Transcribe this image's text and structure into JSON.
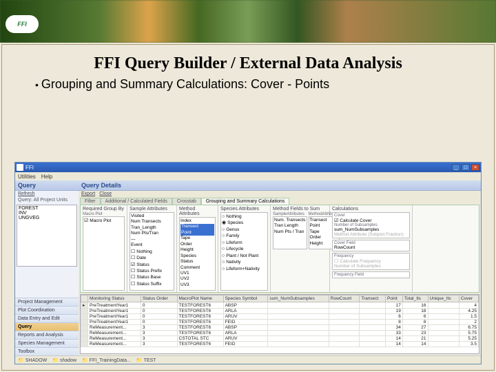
{
  "logo": "FFI",
  "slide": {
    "title": "FFI Query Builder / External Data Analysis",
    "subtitle": "Grouping and Summary Calculations: Cover - Points"
  },
  "app": {
    "title": "FFI",
    "menu": [
      "Utilities",
      "Help"
    ],
    "left": {
      "header": "Query",
      "actions": {
        "refresh": "Refresh"
      },
      "subheader": "Query: All Project Units",
      "tree": [
        "FOREST",
        "INV",
        "UNGVEG"
      ],
      "nav": [
        {
          "label": "Project Management",
          "sel": false
        },
        {
          "label": "Plot Coordination",
          "sel": false
        },
        {
          "label": "Data Entry and Edit",
          "sel": false
        },
        {
          "label": "Query",
          "sel": true
        },
        {
          "label": "Reports and Analysis",
          "sel": false
        },
        {
          "label": "Species Management",
          "sel": false
        },
        {
          "label": "Toolbox",
          "sel": false
        }
      ]
    },
    "details": {
      "header": "Query Details",
      "actions": {
        "export": "Export",
        "close": "Close"
      },
      "tabs": [
        "Filter",
        "Additional / Calculated Fields",
        "Crosstab",
        "Grouping and Summary Calculations"
      ],
      "groupby": {
        "header": "Required Group By",
        "sub": "Macro Plot",
        "items": [
          {
            "label": "Macro Plot",
            "checked": true
          }
        ]
      },
      "sampleAttr": {
        "header": "Sample Attributes",
        "items": [
          {
            "label": "Visited"
          },
          {
            "label": "Num Transects"
          },
          {
            "label": "Tran_Length"
          },
          {
            "label": "Num Pts/Tran"
          },
          {
            "label": "—"
          },
          {
            "label": "Event"
          },
          {
            "label": "Nothing",
            "checked": false
          },
          {
            "label": "Date",
            "checked": false
          },
          {
            "label": "Status",
            "checked": true
          },
          {
            "label": "Status Prefix",
            "checked": false
          },
          {
            "label": "Status Base",
            "checked": false
          },
          {
            "label": "Status Suffix",
            "checked": false
          }
        ]
      },
      "methodAttr": {
        "header": "Method Attributes",
        "items": [
          "Index",
          "Transect",
          "Point",
          "Tape",
          "Order",
          "Height",
          "Species",
          "Status",
          "Comment",
          "UV1",
          "UV2",
          "UV3"
        ],
        "selected": [
          1,
          2
        ]
      },
      "speciesAttr": {
        "header": "Species Attributes",
        "items": [
          {
            "label": "Nothing",
            "sel": false
          },
          {
            "label": "Species",
            "sel": true
          },
          {
            "label": "Genus",
            "sel": false
          },
          {
            "label": "Family",
            "sel": false
          },
          {
            "label": "Lifeform",
            "sel": false
          },
          {
            "label": "Lifecycle",
            "sel": false
          },
          {
            "label": "Plant / Not Plant",
            "sel": false
          },
          {
            "label": "Nativity",
            "sel": false
          },
          {
            "label": "Lifeform+Nativity",
            "sel": false
          }
        ]
      },
      "metrics": {
        "header": "Method Fields to Sum",
        "sampleHdr": "SampleAttributes",
        "sampleItems": [
          "Num. Transects",
          "Tran Length",
          "Num Pts / Tran"
        ],
        "methodHdr": "MethodAttributes",
        "methodItems": [
          "Transect",
          "Point",
          "Tape",
          "Order",
          "Height"
        ]
      },
      "calc": {
        "header": "Calculations",
        "coverLabel": "Cover",
        "coverItems": [
          "Calculate Cover",
          "Number of Subsamples",
          "sum_NumSubsamples",
          "Method Attribute (Subplot Fraction)"
        ],
        "coverFieldLabel": "Cover Field",
        "coverFieldValue": "RowCount",
        "freqLabel": "Frequency",
        "freqItems": [
          "Calculate Frequency",
          "Number of Subsamples"
        ],
        "freqFieldLabel": "Frequency Field"
      }
    },
    "grid": {
      "cols": [
        "Monitoring Status",
        "Status Order",
        "MacroPlot Name",
        "Species Symbol",
        "sum_NumSubsamples",
        "RowCount",
        "Transect",
        "Point",
        "Total_Its",
        "Unique_Its",
        "Cover"
      ],
      "rows": [
        [
          "PreTreatmentYear1",
          "0",
          "TESTFOREST6",
          "ABSP",
          "",
          "",
          "",
          "17",
          "16",
          "",
          "4"
        ],
        [
          "PreTreatmentYear1",
          "0",
          "TESTFOREST6",
          "ARLA",
          "",
          "",
          "",
          "19",
          "18",
          "",
          "4.25"
        ],
        [
          "PreTreatmentYear1",
          "0",
          "TESTFOREST6",
          "ARUV",
          "",
          "",
          "",
          "6",
          "6",
          "",
          "1.5"
        ],
        [
          "PreTreatmentYear1",
          "0",
          "TESTFOREST6",
          "FEID",
          "",
          "",
          "",
          "8",
          "8",
          "",
          "2"
        ],
        [
          "ReMeasurement...",
          "3",
          "TESTFOREST6",
          "ABSP",
          "",
          "",
          "",
          "34",
          "27",
          "",
          "6.75"
        ],
        [
          "ReMeasurement...",
          "3",
          "TESTFOREST6",
          "ARLA",
          "",
          "",
          "",
          "33",
          "23",
          "",
          "5.75"
        ],
        [
          "ReMeasurement...",
          "3",
          "CSTOTAL STC",
          "ARUV",
          "",
          "",
          "",
          "14",
          "21",
          "",
          "5.25"
        ],
        [
          "ReMeasurement...",
          "3",
          "TESTFOREST6",
          "FEID",
          "",
          "",
          "",
          "14",
          "14",
          "",
          "3.5"
        ]
      ]
    },
    "status": [
      "SHADOW",
      "shadow",
      "FFI_TrainingData...",
      "TEST"
    ]
  }
}
